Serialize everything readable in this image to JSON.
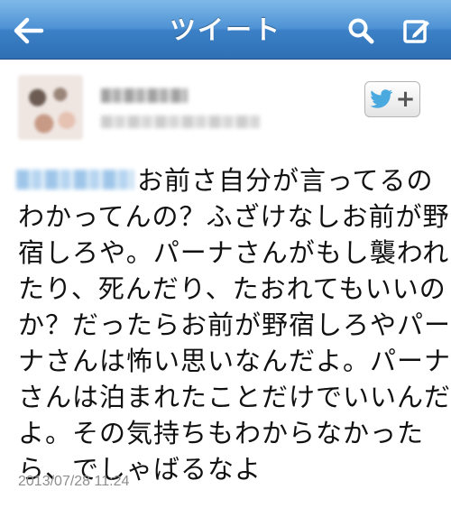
{
  "nav": {
    "title": "ツイート",
    "back_icon": "back-arrow-icon",
    "search_icon": "search-icon",
    "compose_icon": "compose-icon",
    "gradient_top": "#7fb9e8",
    "gradient_bottom": "#2f6fb4"
  },
  "user": {
    "avatar_icon": "avatar",
    "display_name": "",
    "handle": "",
    "follow_icon": "twitter-bird-icon",
    "follow_label": "+"
  },
  "tweet": {
    "mention": "",
    "lines": [
      "お前さ自分が言ってるの",
      "わかってんの？ふざけなしお前が野",
      "宿しろや。パーナさんがもし襲われ",
      "たり、死んだり、たおれてもいいの",
      "か？だったらお前が野宿しろやパー",
      "ナさんは怖い思いなんだよ。パーナ",
      "さんは泊まれたことだけでいいんだ",
      "よ。その気持ちもわからなかった",
      "ら、でしゃばるなよ"
    ],
    "timestamp": "2013/07/28 11:24"
  }
}
